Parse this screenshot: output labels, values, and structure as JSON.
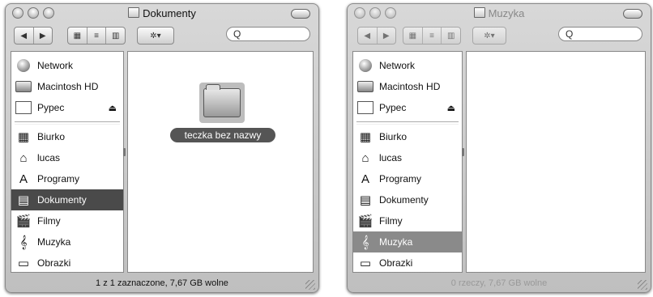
{
  "windows": [
    {
      "title": "Dokumenty",
      "sidebar": {
        "devices": [
          {
            "label": "Network",
            "icon": "network-globe-icon"
          },
          {
            "label": "Macintosh HD",
            "icon": "hard-drive-icon"
          },
          {
            "label": "Pypec",
            "icon": "disk-icon",
            "eject": "⏏"
          }
        ],
        "places": [
          {
            "label": "Biurko",
            "icon": "desktop-icon"
          },
          {
            "label": "lucas",
            "icon": "home-icon"
          },
          {
            "label": "Programy",
            "icon": "applications-icon"
          },
          {
            "label": "Dokumenty",
            "icon": "documents-icon",
            "selected": true
          },
          {
            "label": "Filmy",
            "icon": "movies-icon"
          },
          {
            "label": "Muzyka",
            "icon": "music-icon"
          },
          {
            "label": "Obrazki",
            "icon": "pictures-icon"
          }
        ]
      },
      "content": {
        "folder_name": "teczka bez nazwy"
      },
      "status": "1 z 1 zaznaczone, 7,67 GB wolne"
    },
    {
      "title": "Muzyka",
      "sidebar": {
        "devices": [
          {
            "label": "Network",
            "icon": "network-globe-icon"
          },
          {
            "label": "Macintosh HD",
            "icon": "hard-drive-icon"
          },
          {
            "label": "Pypec",
            "icon": "disk-icon",
            "eject": "⏏"
          }
        ],
        "places": [
          {
            "label": "Biurko",
            "icon": "desktop-icon"
          },
          {
            "label": "lucas",
            "icon": "home-icon"
          },
          {
            "label": "Programy",
            "icon": "applications-icon"
          },
          {
            "label": "Dokumenty",
            "icon": "documents-icon"
          },
          {
            "label": "Filmy",
            "icon": "movies-icon"
          },
          {
            "label": "Muzyka",
            "icon": "music-icon",
            "selected": true
          },
          {
            "label": "Obrazki",
            "icon": "pictures-icon"
          }
        ]
      },
      "status": "0 rzeczy, 7,67 GB wolne"
    }
  ],
  "toolbar_glyphs": {
    "back": "◀",
    "forward": "▶",
    "view_icon": "▦",
    "view_list": "≡",
    "view_column": "▥",
    "action": "✲▾",
    "search": "Q"
  },
  "icon_glyphs": {
    "desktop": "▦",
    "home": "⌂",
    "applications": "A",
    "documents": "▤",
    "movies": "🎬",
    "music": "𝄞",
    "pictures": "▭"
  }
}
